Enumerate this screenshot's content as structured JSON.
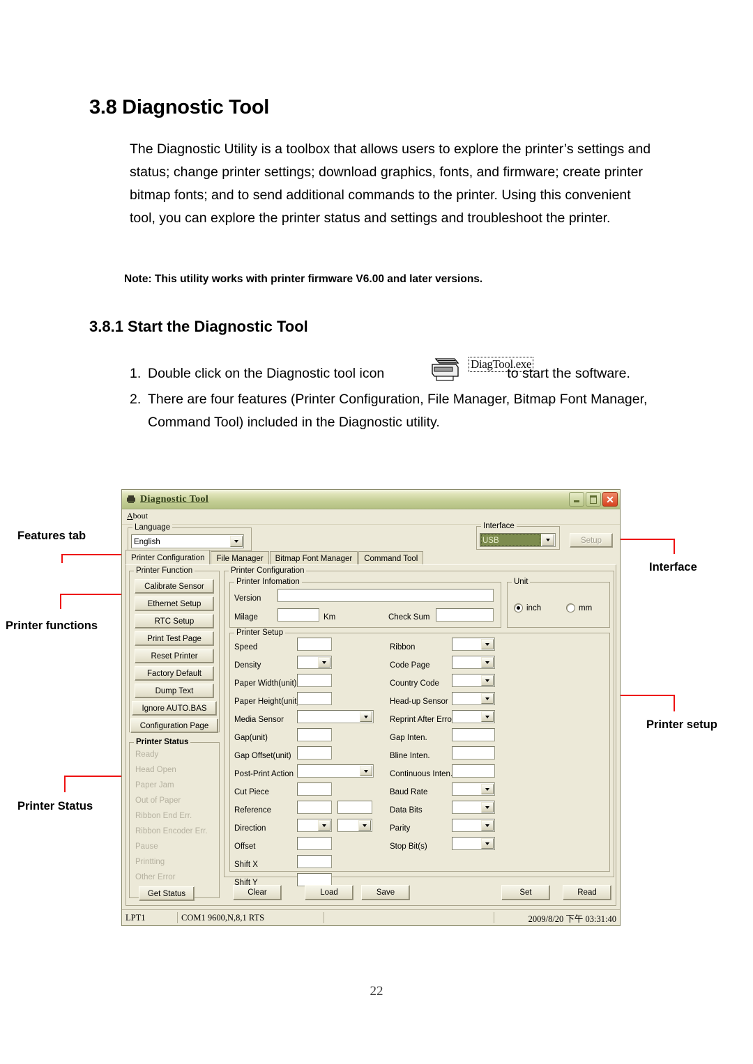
{
  "document": {
    "h1": "3.8 Diagnostic Tool",
    "paragraph": "The Diagnostic Utility is a toolbox that allows users to explore the printer’s settings and status; change printer settings; download graphics, fonts, and firmware; create printer bitmap fonts; and to send additional commands to the printer. Using this convenient tool, you can explore the printer status and settings and troubleshoot the printer.",
    "note": "Note: This utility works with printer firmware V6.00 and later versions.",
    "h2": "3.8.1 Start the Diagnostic Tool",
    "list": [
      {
        "num": "1.",
        "before": "Double click on the Diagnostic tool icon",
        "after": "to start the software."
      },
      {
        "num": "2.",
        "text": "There are four features (Printer Configuration, File Manager, Bitmap Font Manager, Command Tool) included in the Diagnostic utility."
      }
    ],
    "exe_label": "DiagTool.exe",
    "page_number": "22"
  },
  "annotations": [
    {
      "label": "Features tab"
    },
    {
      "label": "Printer functions"
    },
    {
      "label": "Printer Status"
    },
    {
      "label": "Interface"
    },
    {
      "label": "Printer setup"
    }
  ],
  "window": {
    "title": "Diagnostic Tool",
    "menu": {
      "about": "About",
      "about_accel": "A",
      "about_rest": "bout"
    },
    "window_buttons": {
      "minimize": "–",
      "maximize": "□",
      "close": "✕"
    },
    "language": {
      "caption": "Language",
      "value": "English"
    },
    "interface": {
      "caption": "Interface",
      "value": "USB",
      "setup_button": "Setup"
    },
    "tabs": [
      {
        "label": "Printer Configuration",
        "active": true
      },
      {
        "label": "File Manager",
        "active": false
      },
      {
        "label": "Bitmap Font Manager",
        "active": false
      },
      {
        "label": "Command Tool",
        "active": false
      }
    ],
    "printer_function": {
      "caption": "Printer Function",
      "buttons": [
        "Calibrate Sensor",
        "Ethernet Setup",
        "RTC Setup",
        "Print Test Page",
        "Reset Printer",
        "Factory Default",
        "Dump Text",
        "Ignore AUTO.BAS",
        "Configuration Page"
      ]
    },
    "printer_status": {
      "caption": "Printer Status",
      "items": [
        "Ready",
        "Head Open",
        "Paper Jam",
        "Out of Paper",
        "Ribbon End Err.",
        "Ribbon Encoder Err.",
        "Pause",
        "Printting",
        "Other Error"
      ],
      "get_status_button": "Get Status"
    },
    "printer_configuration": {
      "caption": "Printer Configuration",
      "printer_information": {
        "caption": "Printer Infomation",
        "version_label": "Version",
        "version_value": "",
        "milage_label": "Milage",
        "milage_value": "",
        "milage_unit": "Km",
        "checksum_label": "Check Sum",
        "checksum_value": ""
      },
      "unit": {
        "caption": "Unit",
        "options": [
          {
            "label": "inch",
            "selected": true
          },
          {
            "label": "mm",
            "selected": false
          }
        ]
      },
      "printer_setup": {
        "caption": "Printer Setup",
        "left_fields": [
          {
            "label": "Speed",
            "type": "text",
            "value": ""
          },
          {
            "label": "Density",
            "type": "combo",
            "value": ""
          },
          {
            "label": "Paper Width(unit)",
            "type": "text",
            "value": ""
          },
          {
            "label": "Paper Height(unit)",
            "type": "text",
            "value": ""
          },
          {
            "label": "Media Sensor",
            "type": "combo-wide",
            "value": ""
          },
          {
            "label": "Gap(unit)",
            "type": "text",
            "value": ""
          },
          {
            "label": "Gap Offset(unit)",
            "type": "text",
            "value": ""
          },
          {
            "label": "Post-Print Action",
            "type": "combo-wide",
            "value": ""
          },
          {
            "label": "Cut Piece",
            "type": "text",
            "value": ""
          },
          {
            "label": "Reference",
            "type": "text-pair",
            "value": "",
            "value2": ""
          },
          {
            "label": "Direction",
            "type": "combo-pair",
            "value": "",
            "value2": ""
          },
          {
            "label": "Offset",
            "type": "text",
            "value": ""
          },
          {
            "label": "Shift X",
            "type": "text",
            "value": ""
          },
          {
            "label": "Shift Y",
            "type": "text",
            "value": ""
          }
        ],
        "right_fields": [
          {
            "label": "Ribbon",
            "type": "combo",
            "value": ""
          },
          {
            "label": "Code Page",
            "type": "combo",
            "value": ""
          },
          {
            "label": "Country Code",
            "type": "combo",
            "value": ""
          },
          {
            "label": "Head-up Sensor",
            "type": "combo",
            "value": ""
          },
          {
            "label": "Reprint After Error",
            "type": "combo",
            "value": ""
          },
          {
            "label": "Gap Inten.",
            "type": "text",
            "value": ""
          },
          {
            "label": "Bline Inten.",
            "type": "text",
            "value": ""
          },
          {
            "label": "Continuous Inten.",
            "type": "text",
            "value": ""
          },
          {
            "label": "Baud Rate",
            "type": "combo",
            "value": ""
          },
          {
            "label": "Data Bits",
            "type": "combo",
            "value": ""
          },
          {
            "label": "Parity",
            "type": "combo",
            "value": ""
          },
          {
            "label": "Stop Bit(s)",
            "type": "combo",
            "value": ""
          }
        ],
        "action_buttons": [
          "Clear",
          "Load",
          "Save",
          "Set",
          "Read"
        ]
      }
    },
    "statusbar": {
      "port": "LPT1",
      "comsettings": "COM1 9600,N,8,1 RTS",
      "middle": "",
      "datetime": "2009/8/20 下午 03:31:40"
    }
  },
  "colors": {
    "annotation_red": "#ee1111",
    "window_bg": "#ECE9D8",
    "titlebar_olive": "#c3ce94",
    "selection_green": "#7d8c4e"
  }
}
